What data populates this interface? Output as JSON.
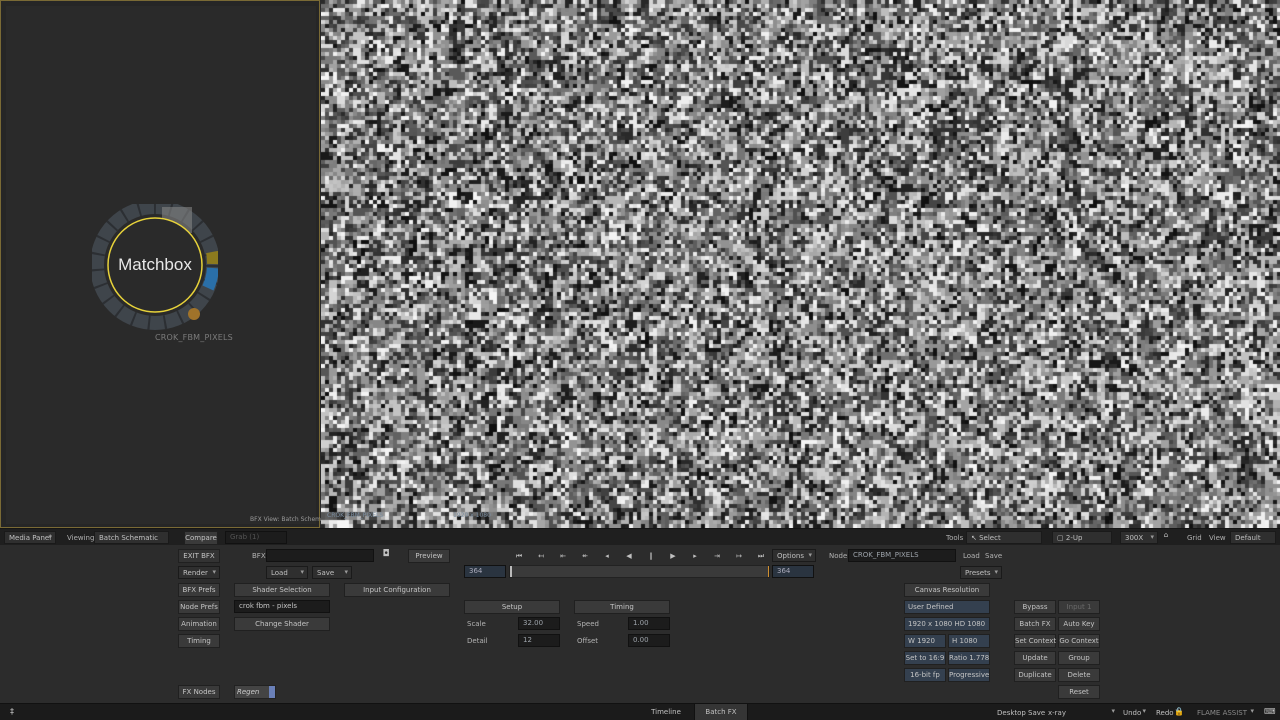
{
  "schematic": {
    "node_title": "Matchbox",
    "node_name": "CROK_FBM_PIXELS",
    "footer": "BFX View: Batch Schematic"
  },
  "viewer": {
    "overlay_left": "CROK_FBM_PIXELS",
    "overlay_right": "1920 x 1080"
  },
  "viewbar": {
    "media_panel": "Media Panel",
    "viewing_label": "Viewing",
    "viewing_value": "Batch Schematic",
    "compare": "Compare",
    "grab": "Grab (1)",
    "tools_label": "Tools",
    "select": "Select",
    "layout": "2-Up",
    "zoom": "300X",
    "grid": "Grid",
    "view": "View",
    "default": "Default"
  },
  "panel": {
    "exit_bfx": "EXIT BFX",
    "bfx_label": "BFX",
    "preview": "Preview",
    "render": "Render",
    "load": "Load",
    "save": "Save",
    "options": "Options",
    "frame_start": "364",
    "frame_end": "364",
    "node_label": "Node",
    "node_value": "CROK_FBM_PIXELS",
    "node_load": "Load",
    "node_save": "Save",
    "presets": "Presets",
    "bfx_prefs": "BFX Prefs",
    "node_prefs": "Node Prefs",
    "animation": "Animation",
    "timing_btn": "Timing",
    "shader_selection": "Shader Selection",
    "shader_name": "crok fbm - pixels",
    "change_shader": "Change Shader",
    "input_configuration": "Input Configuration",
    "fx_nodes": "FX Nodes",
    "regen": "Regen",
    "setup_tab": "Setup",
    "timing_tab": "Timing",
    "scale_label": "Scale",
    "scale_value": "32.00",
    "detail_label": "Detail",
    "detail_value": "12",
    "speed_label": "Speed",
    "speed_value": "1.00",
    "offset_label": "Offset",
    "offset_value": "0.00",
    "canvas_resolution": "Canvas Resolution",
    "user_defined": "User Defined",
    "res_preset": "1920 x 1080 HD 1080",
    "width": "W 1920",
    "height": "H 1080",
    "set_to": "Set to 16:9",
    "ratio": "Ratio 1.778",
    "bit_depth": "16-bit fp",
    "scan": "Progressive",
    "bypass": "Bypass",
    "input": "Input 1",
    "batch_fx": "Batch FX",
    "auto_key": "Auto Key",
    "set_context": "Set Context",
    "go_context": "Go Context",
    "update": "Update",
    "group": "Group",
    "duplicate": "Duplicate",
    "delete": "Delete",
    "reset": "Reset"
  },
  "status": {
    "left_glyph": "‡",
    "tab_timeline": "Timeline",
    "tab_batchfx": "Batch FX",
    "desktop": "Desktop",
    "save": "Save",
    "project": "x-ray",
    "undo": "Undo",
    "redo": "Redo",
    "app": "FLAME ASSIST"
  },
  "colors": {
    "accent_yellow": "#e7d23a",
    "node_ring": "#4a4f55",
    "input_blue": "#2a6fa8",
    "input_yellow": "#8c7a1e",
    "input_orange": "#a0732a"
  }
}
